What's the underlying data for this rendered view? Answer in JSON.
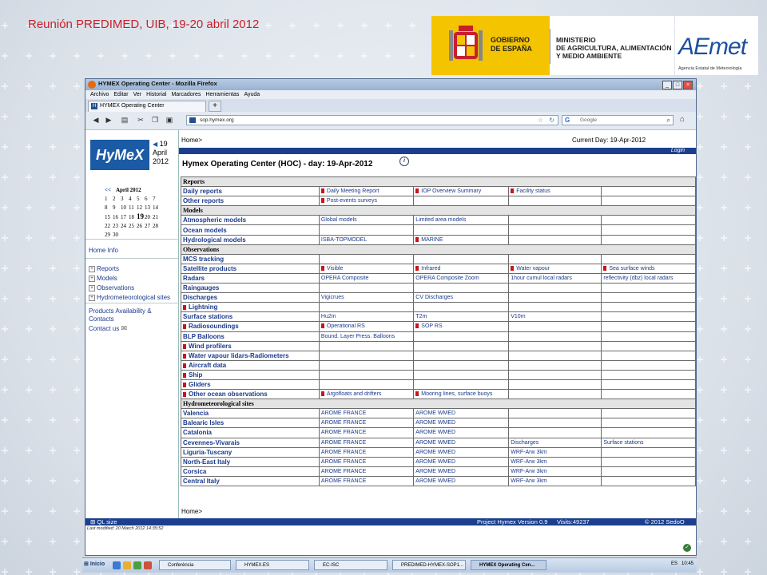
{
  "slide": {
    "title": "Reunión PREDIMED, UIB, 19-20 abril 2012",
    "gov_logo_line1": "GOBIERNO",
    "gov_logo_line2": "DE ESPAÑA",
    "ministry_line1": "MINISTERIO",
    "ministry_line2": "DE AGRICULTURA, ALIMENTACIÓN",
    "ministry_line3": "Y MEDIO AMBIENTE",
    "aemet_word": "AEmet",
    "aemet_subtitle": "Agencia Estatal de Meteorología"
  },
  "browser": {
    "window_title": "HYMEX Operating Center - Mozilla Firefox",
    "menu": [
      "Archivo",
      "Editar",
      "Ver",
      "Historial",
      "Marcadores",
      "Herramientas",
      "Ayuda"
    ],
    "tab_label": "HYMEX Operating Center",
    "url": "sop.hymex.org",
    "search_engine": "Google"
  },
  "sidebar": {
    "logo_text": "HyMeX",
    "day": "19",
    "month": "April",
    "year": "2012",
    "calendar_prev": "<<",
    "calendar_title": "April 2012",
    "calendar_rows": [
      [
        "1",
        "2",
        "3",
        "4",
        "5",
        "6",
        "7"
      ],
      [
        "8",
        "9",
        "10",
        "11",
        "12",
        "13",
        "14"
      ],
      [
        "15",
        "16",
        "17",
        "18",
        "19",
        "20",
        "21"
      ],
      [
        "22",
        "23",
        "24",
        "25",
        "26",
        "27",
        "28"
      ],
      [
        "29",
        "30"
      ]
    ],
    "home_info": "Home Info",
    "tree": [
      "Reports",
      "Models",
      "Observations",
      "Hydrometeorological sites"
    ],
    "products_link": "Products Availability & Contacts",
    "contact_link": "Contact us"
  },
  "main": {
    "breadcrumb": "Home>",
    "current_day": "Current Day: 19-Apr-2012",
    "login": "Login",
    "heading": "Hymex Operating Center (HOC) - day: 19-Apr-2012",
    "footer_breadcrumb": "Home>"
  },
  "table": [
    {
      "section": "Reports"
    },
    {
      "item": "Daily reports",
      "cells": [
        {
          "t": "Daily Meeting Report",
          "pdf": true
        },
        {
          "t": "IOP Overview Summary",
          "pdf": true
        },
        {
          "t": "Facility status",
          "pdf": true
        },
        {
          "t": ""
        }
      ]
    },
    {
      "item": "Other reports",
      "cells": [
        {
          "t": "Post-events surveys",
          "pdf": true
        },
        {
          "t": ""
        },
        {
          "t": ""
        },
        {
          "t": ""
        }
      ]
    },
    {
      "section": "Models"
    },
    {
      "item": "Atmospheric models",
      "cells": [
        {
          "t": "Global models"
        },
        {
          "t": "Limited area models"
        },
        {
          "t": ""
        },
        {
          "t": ""
        }
      ]
    },
    {
      "item": "Ocean models",
      "cells": [
        {
          "t": ""
        },
        {
          "t": ""
        },
        {
          "t": ""
        },
        {
          "t": ""
        }
      ]
    },
    {
      "item": "Hydrological models",
      "cells": [
        {
          "t": "ISBA-TOPMODEL"
        },
        {
          "t": "MARINE",
          "pdf": true
        },
        {
          "t": ""
        },
        {
          "t": ""
        }
      ]
    },
    {
      "section": "Observations"
    },
    {
      "item": "MCS tracking",
      "cells": [
        {
          "t": ""
        },
        {
          "t": ""
        },
        {
          "t": ""
        },
        {
          "t": ""
        }
      ]
    },
    {
      "item": "Satellite products",
      "cells": [
        {
          "t": "Visible",
          "pdf": true
        },
        {
          "t": "Infrared",
          "pdf": true
        },
        {
          "t": "Water vapour",
          "pdf": true
        },
        {
          "t": "Sea surface winds",
          "pdf": true
        }
      ]
    },
    {
      "item": "Radars",
      "cells": [
        {
          "t": "OPERA Composite"
        },
        {
          "t": "OPERA Composite Zoom"
        },
        {
          "t": "1hour cumul local radars"
        },
        {
          "t": "reflectivity (dbz) local radars"
        }
      ]
    },
    {
      "item": "Raingauges",
      "cells": [
        {
          "t": ""
        },
        {
          "t": ""
        },
        {
          "t": ""
        },
        {
          "t": ""
        }
      ]
    },
    {
      "item": "Discharges",
      "cells": [
        {
          "t": "Vigicrues"
        },
        {
          "t": "CV Discharges"
        },
        {
          "t": ""
        },
        {
          "t": ""
        }
      ]
    },
    {
      "item": "Lightning",
      "pdf": true,
      "cells": [
        {
          "t": ""
        },
        {
          "t": ""
        },
        {
          "t": ""
        },
        {
          "t": ""
        }
      ]
    },
    {
      "item": "Surface stations",
      "cells": [
        {
          "t": "Hu2m"
        },
        {
          "t": "T2m"
        },
        {
          "t": "V10m"
        },
        {
          "t": ""
        }
      ]
    },
    {
      "item": "Radiosoundings",
      "pdf": true,
      "cells": [
        {
          "t": "Operational RS",
          "pdf": true
        },
        {
          "t": "SOP RS",
          "pdf": true
        },
        {
          "t": ""
        },
        {
          "t": ""
        }
      ]
    },
    {
      "item": "BLP Balloons",
      "cells": [
        {
          "t": "Bound. Layer Press. Balloons"
        },
        {
          "t": ""
        },
        {
          "t": ""
        },
        {
          "t": ""
        }
      ]
    },
    {
      "item": "Wind profilers",
      "pdf": true,
      "cells": [
        {
          "t": ""
        },
        {
          "t": ""
        },
        {
          "t": ""
        },
        {
          "t": ""
        }
      ]
    },
    {
      "item": "Water vapour lidars-Radiometers",
      "pdf": true,
      "cells": [
        {
          "t": ""
        },
        {
          "t": ""
        },
        {
          "t": ""
        },
        {
          "t": ""
        }
      ]
    },
    {
      "item": "Aircraft data",
      "pdf": true,
      "cells": [
        {
          "t": ""
        },
        {
          "t": ""
        },
        {
          "t": ""
        },
        {
          "t": ""
        }
      ]
    },
    {
      "item": "Ship",
      "pdf": true,
      "cells": [
        {
          "t": ""
        },
        {
          "t": ""
        },
        {
          "t": ""
        },
        {
          "t": ""
        }
      ]
    },
    {
      "item": "Gliders",
      "pdf": true,
      "cells": [
        {
          "t": ""
        },
        {
          "t": ""
        },
        {
          "t": ""
        },
        {
          "t": ""
        }
      ]
    },
    {
      "item": "Other ocean observations",
      "pdf": true,
      "cells": [
        {
          "t": "Argofloats and drifters",
          "pdf": true
        },
        {
          "t": "Mooring lines, surface buoys",
          "pdf": true
        },
        {
          "t": ""
        },
        {
          "t": ""
        }
      ]
    },
    {
      "section": "Hydrometeorological sites"
    },
    {
      "item": "Valencia",
      "cells": [
        {
          "t": "AROME FRANCE"
        },
        {
          "t": "AROME WMED"
        },
        {
          "t": ""
        },
        {
          "t": ""
        }
      ]
    },
    {
      "item": "Balearic Isles",
      "cells": [
        {
          "t": "AROME FRANCE"
        },
        {
          "t": "AROME WMED"
        },
        {
          "t": ""
        },
        {
          "t": ""
        }
      ]
    },
    {
      "item": "Catalonia",
      "cells": [
        {
          "t": "AROME FRANCE"
        },
        {
          "t": "AROME WMED"
        },
        {
          "t": ""
        },
        {
          "t": ""
        }
      ]
    },
    {
      "item": "Cevennes-Vivarais",
      "cells": [
        {
          "t": "AROME FRANCE"
        },
        {
          "t": "AROME WMED"
        },
        {
          "t": "Discharges"
        },
        {
          "t": "Surface stations"
        }
      ]
    },
    {
      "item": "Liguria-Tuscany",
      "cells": [
        {
          "t": "AROME FRANCE"
        },
        {
          "t": "AROME WMED"
        },
        {
          "t": "WRF-Arw 3km"
        },
        {
          "t": ""
        }
      ]
    },
    {
      "item": "North-East Italy",
      "cells": [
        {
          "t": "AROME FRANCE"
        },
        {
          "t": "AROME WMED"
        },
        {
          "t": "WRF-Arw 3km"
        },
        {
          "t": ""
        }
      ]
    },
    {
      "item": "Corsica",
      "cells": [
        {
          "t": "AROME FRANCE"
        },
        {
          "t": "AROME WMED"
        },
        {
          "t": "WRF-Arw 3km"
        },
        {
          "t": ""
        }
      ]
    },
    {
      "item": "Central Italy",
      "cells": [
        {
          "t": "AROME FRANCE"
        },
        {
          "t": "AROME WMED"
        },
        {
          "t": "WRF-Arw 3km"
        },
        {
          "t": ""
        }
      ]
    }
  ],
  "footer": {
    "ql_size": "QL size",
    "project_version": "Project Hymex Version 0.9",
    "visits": "Visits:49237",
    "copyright": "© 2012 SedoO",
    "last_modified": "Last modified: 20 March 2012 14:35:52"
  },
  "taskbar": {
    "start": "Inicio",
    "tasks": [
      "Conferència",
      "HYMEX.ES",
      "EC-ISC",
      "PREDIMED-HYMEX-SOP1...",
      "HYMEX Operating Cen..."
    ],
    "lang": "ES",
    "clock": "10:45"
  },
  "colors": {
    "slide_title": "#c8202a",
    "hymex_blue": "#1b3f8e",
    "link": "#1a3a8c",
    "pdf_icon": "#c8141c"
  }
}
